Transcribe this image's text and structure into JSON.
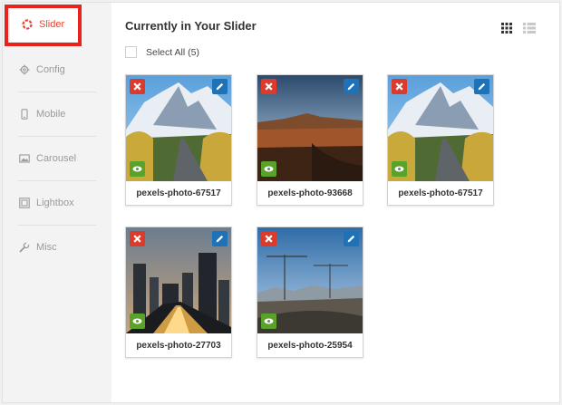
{
  "sidebar": {
    "items": [
      {
        "label": "Slider",
        "icon": "lifebuoy-icon",
        "active": true
      },
      {
        "label": "Config",
        "icon": "gear-icon"
      },
      {
        "label": "Mobile",
        "icon": "mobile-icon"
      },
      {
        "label": "Carousel",
        "icon": "carousel-icon"
      },
      {
        "label": "Lightbox",
        "icon": "lightbox-icon"
      },
      {
        "label": "Misc",
        "icon": "wrench-icon"
      }
    ]
  },
  "main": {
    "title": "Currently in Your Slider",
    "select_all_label": "Select All (5)",
    "view_modes": [
      "grid-view",
      "list-view"
    ],
    "active_view": "grid-view"
  },
  "slides": [
    {
      "name": "pexels-photo-67517",
      "image": "mountain-road"
    },
    {
      "name": "pexels-photo-93668",
      "image": "canyon-sunset"
    },
    {
      "name": "pexels-photo-67517",
      "image": "mountain-road"
    },
    {
      "name": "pexels-photo-27703",
      "image": "city-night"
    },
    {
      "name": "pexels-photo-25954",
      "image": "construction-site"
    }
  ],
  "colors": {
    "accent": "#e8452c",
    "highlight_outline": "#e8231b",
    "delete": "#dc3a2a",
    "edit": "#1d72b8",
    "view": "#5aa32a"
  }
}
